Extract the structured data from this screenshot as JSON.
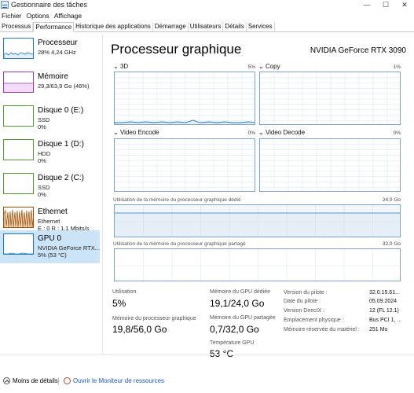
{
  "window": {
    "title": "Gestionnaire des tâches",
    "controls": [
      "—",
      "☐",
      "✕"
    ]
  },
  "menu": [
    "Fichier",
    "Options",
    "Affichage"
  ],
  "tabs": [
    {
      "label": "Processus",
      "active": false
    },
    {
      "label": "Performance",
      "active": true
    },
    {
      "label": "Historique des applications",
      "active": false
    },
    {
      "label": "Démarrage",
      "active": false
    },
    {
      "label": "Utilisateurs",
      "active": false
    },
    {
      "label": "Détails",
      "active": false
    },
    {
      "label": "Services",
      "active": false
    }
  ],
  "sidebar": {
    "items": [
      {
        "name": "Processeur",
        "line1": "28%  4,24 GHz",
        "line2": "",
        "color": "#1f78c8"
      },
      {
        "name": "Mémoire",
        "line1": "29,3/63,9 Go (46%)",
        "line2": "",
        "color": "#9b3ab0"
      },
      {
        "name": "Disque 0 (E:)",
        "line1": "SSD",
        "line2": "0%",
        "color": "#4aa02c"
      },
      {
        "name": "Disque 1 (D:)",
        "line1": "HDD",
        "line2": "0%",
        "color": "#4aa02c"
      },
      {
        "name": "Disque 2 (C:)",
        "line1": "SSD",
        "line2": "0%",
        "color": "#4aa02c"
      },
      {
        "name": "Ethernet",
        "line1": "Ethernet",
        "line2": "E : 0  R : 1,1 Mbits/s",
        "color": "#a74f01"
      },
      {
        "name": "GPU 0",
        "line1": "NVIDIA GeForce RTX...",
        "line2": "5%  (53 °C)",
        "color": "#1f78c8"
      }
    ]
  },
  "main": {
    "title": "Processeur graphique",
    "model": "NVIDIA GeForce RTX 3090",
    "engines": [
      {
        "label": "3D",
        "pct": "5%",
        "pct_value": 5
      },
      {
        "label": "Copy",
        "pct": "1%",
        "pct_value": 1
      },
      {
        "label": "Video Encode",
        "pct": "0%",
        "pct_value": 0
      },
      {
        "label": "Video Decode",
        "pct": "0%",
        "pct_value": 0
      }
    ],
    "dedicated_mem": {
      "label": "Utilisation de la mémoire du processeur graphique dédié",
      "max": "24,0 Go"
    },
    "shared_mem": {
      "label": "Utilisation de la mémoire du processeur graphique partagé",
      "max": "32,0 Go"
    },
    "stats": {
      "utilisation_label": "Utilisation",
      "utilisation_value": "5%",
      "gpu_mem_label": "Mémoire du processeur graphique",
      "gpu_mem_value": "19,8/56,0 Go",
      "dedicated_label": "Mémoire du GPU dédiée",
      "dedicated_value": "19,1/24,0 Go",
      "shared_label": "Mémoire du GPU partagée",
      "shared_value": "0,7/32,0 Go",
      "temp_label": "Température GPU",
      "temp_value": "53 °C"
    },
    "info": [
      {
        "label": "Version du pilote :",
        "value": "32.0.15.61..."
      },
      {
        "label": "Date du pilote :",
        "value": "05.09.2024"
      },
      {
        "label": "Version DirectX :",
        "value": "12 (FL 12.1)"
      },
      {
        "label": "Emplacement physique :",
        "value": "Bus PCI 1, ..."
      },
      {
        "label": "Mémoire réservée du matériel :",
        "value": "251 Mo"
      }
    ]
  },
  "footer": {
    "fewer_details": "Moins de détails",
    "resource_monitor": "Ouvrir le Moniteur de ressources"
  }
}
